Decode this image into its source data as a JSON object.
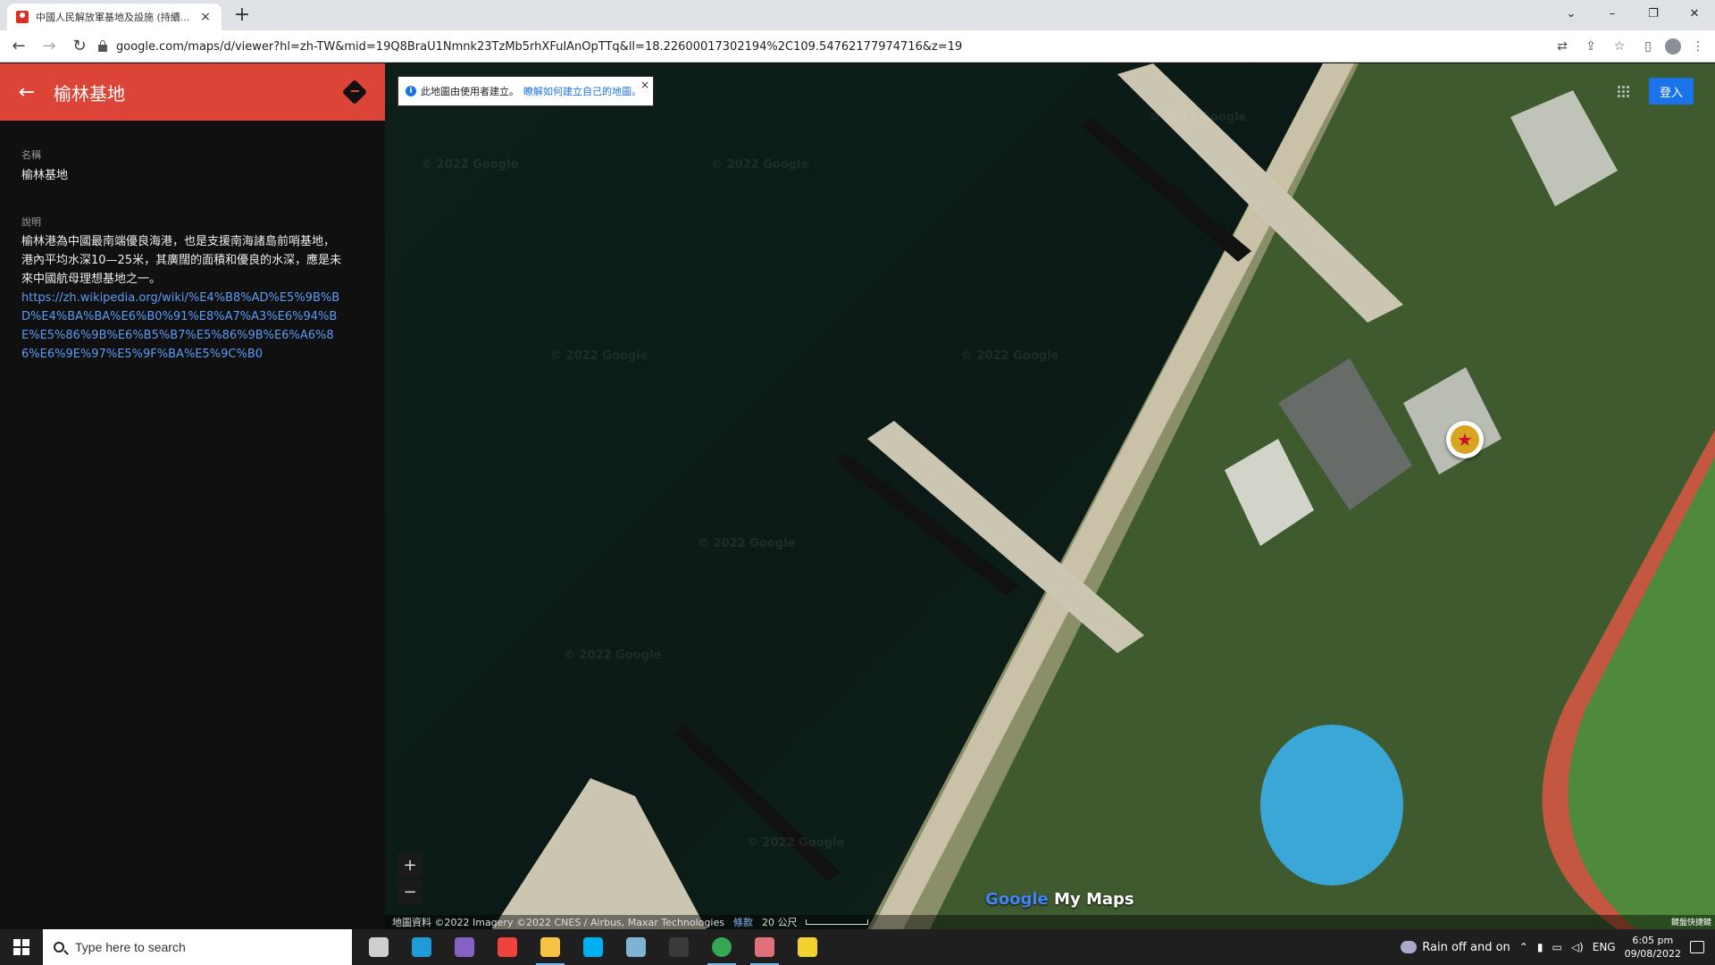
{
  "browser": {
    "tab_title": "中國人民解放軍基地及設施 (持續...",
    "tab_close": "×",
    "new_tab": "+",
    "url": "google.com/maps/d/viewer?hl=zh-TW&mid=19Q8BraU1Nmnk23TzMb5rhXFuIAnOpTTq&ll=18.22600017302194%2C109.54762177974716&z=19",
    "window_controls": [
      "⌄",
      "–",
      "❐",
      "✕"
    ]
  },
  "panel": {
    "title": "榆林基地",
    "name_label": "名稱",
    "name_value": "榆林基地",
    "description_label": "說明",
    "description_text": "榆林港為中國最南端優良海港，也是支援南海諸島前哨基地，港內平均水深10—25米，其廣闊的面積和優良的水深，應是未來中國航母理想基地之一。",
    "description_link": "https://zh.wikipedia.org/wiki/%E4%B8%AD%E5%9B%BD%E4%BA%BA%E6%B0%91%E8%A7%A3%E6%94%BE%E5%86%9B%E6%B5%B7%E5%86%9B%E6%A6%86%E6%9E%97%E5%9F%BA%E5%9C%B0"
  },
  "map": {
    "notice_text": "此地圖由使用者建立。",
    "notice_link": "瞭解如何建立自己的地圖。",
    "notice_close": "×",
    "signin_label": "登入",
    "zoom_in": "+",
    "zoom_out": "−",
    "watermark": "© 2022 Google",
    "brand_google": "Google",
    "brand_mymaps": " My Maps",
    "attribution": "地圖資料 ©2022 Imagery ©2022 CNES / Airbus, Maxar Technologies",
    "terms": "條款",
    "scale": "20 公尺",
    "corner_label": "鍵盤快捷鍵",
    "marker_icon": "★"
  },
  "taskbar": {
    "search_placeholder": "Type here to search",
    "weather": "Rain off and on",
    "language": "ENG",
    "time": "6:05 pm",
    "date": "09/08/2022",
    "apps": [
      {
        "name": "task-view-icon",
        "color": "#cfcfcf"
      },
      {
        "name": "edge-icon",
        "color": "#1f9cd8"
      },
      {
        "name": "visual-studio-icon",
        "color": "#8661c5"
      },
      {
        "name": "anydesk-icon",
        "color": "#ef443b"
      },
      {
        "name": "file-explorer-icon",
        "color": "#f6c343"
      },
      {
        "name": "skype-icon",
        "color": "#00aff0"
      },
      {
        "name": "app-icon",
        "color": "#7fb3d5"
      },
      {
        "name": "terminal-icon",
        "color": "#3a3a3a"
      },
      {
        "name": "chrome-icon",
        "color": "#34a853"
      },
      {
        "name": "snipping-icon",
        "color": "#e0707a"
      },
      {
        "name": "sticky-notes-icon",
        "color": "#f2d230"
      }
    ]
  }
}
